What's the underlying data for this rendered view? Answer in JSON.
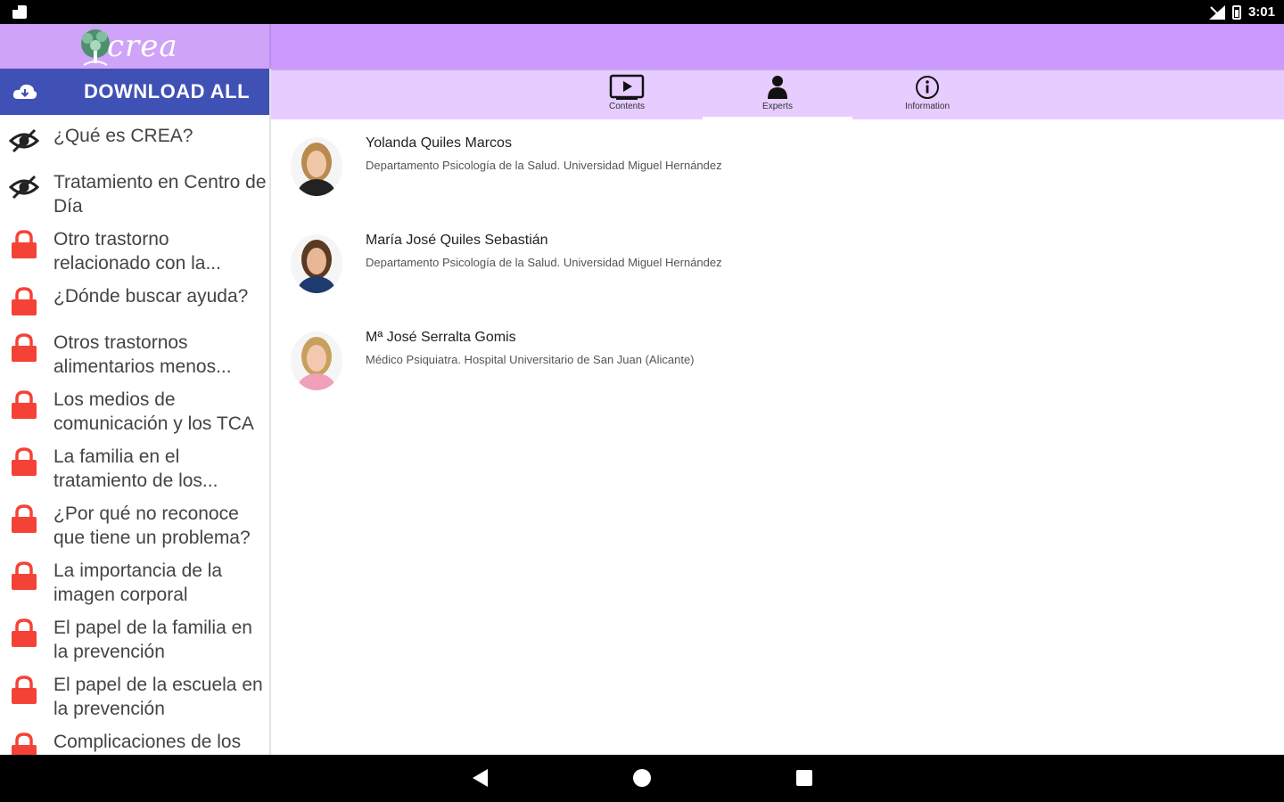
{
  "status_bar": {
    "time": "3:01"
  },
  "header": {
    "logo_text": "crea"
  },
  "sidebar": {
    "download_label": "DOWNLOAD ALL",
    "items": [
      {
        "label": "¿Qué es CREA?",
        "icon": "eye-off-icon",
        "locked": false
      },
      {
        "label": "Tratamiento en Centro de Día",
        "icon": "eye-off-icon",
        "locked": false
      },
      {
        "label": "Otro trastorno relacionado con la...",
        "icon": "lock-icon",
        "locked": true
      },
      {
        "label": "¿Dónde buscar ayuda?",
        "icon": "lock-icon",
        "locked": true
      },
      {
        "label": "Otros trastornos alimentarios menos...",
        "icon": "lock-icon",
        "locked": true
      },
      {
        "label": "Los medios de comunicación y los TCA",
        "icon": "lock-icon",
        "locked": true
      },
      {
        "label": "La familia en el tratamiento de los...",
        "icon": "lock-icon",
        "locked": true
      },
      {
        "label": "¿Por qué no reconoce que tiene un problema?",
        "icon": "lock-icon",
        "locked": true
      },
      {
        "label": "La importancia de la imagen corporal",
        "icon": "lock-icon",
        "locked": true
      },
      {
        "label": "El papel de la familia en la prevención",
        "icon": "lock-icon",
        "locked": true
      },
      {
        "label": "El papel de la escuela en la prevención",
        "icon": "lock-icon",
        "locked": true
      },
      {
        "label": "Complicaciones de los",
        "icon": "lock-icon",
        "locked": true
      }
    ]
  },
  "tabs": [
    {
      "label": "Contents",
      "icon": "play-icon",
      "active": false
    },
    {
      "label": "Experts",
      "icon": "person-icon",
      "active": true
    },
    {
      "label": "Information",
      "icon": "info-icon",
      "active": false
    }
  ],
  "experts": [
    {
      "name": "Yolanda Quiles Marcos",
      "affiliation": "Departamento Psicología de la Salud. Universidad Miguel Hernández"
    },
    {
      "name": "María José Quiles Sebastián",
      "affiliation": "Departamento Psicología de la Salud. Universidad Miguel Hernández"
    },
    {
      "name": "Mª José Serralta Gomis",
      "affiliation": "Médico Psiquiatra. Hospital Universitario de San Juan (Alicante)"
    }
  ],
  "colors": {
    "header": "#cc99ff",
    "tabs_bg": "#e6ccff",
    "download_bg": "#3f51b5",
    "lock": "#f44336"
  }
}
